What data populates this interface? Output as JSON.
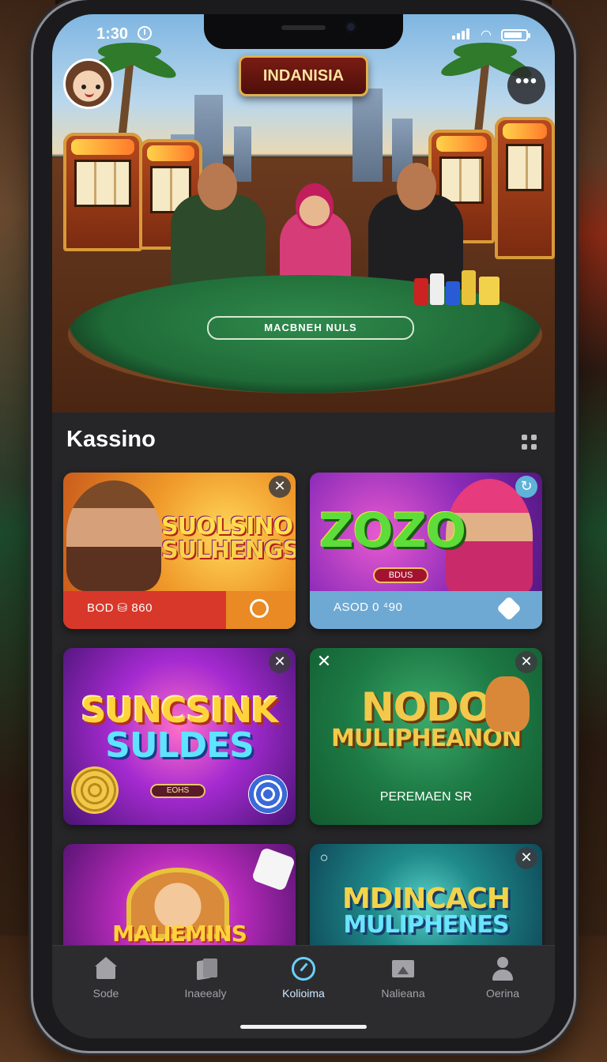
{
  "status_bar": {
    "time": "1:30"
  },
  "hero": {
    "banner": "INDANISIA",
    "table_text": "MACBNEH NULS"
  },
  "section": {
    "title": "Kassino"
  },
  "cards": [
    {
      "title_line1": "SUOLSINO",
      "title_line2": "SULHENGS",
      "bar_label": "BOD ⛁ 860",
      "badge": ""
    },
    {
      "title_line1": "ZOZO",
      "title_line2": "",
      "bar_label": "ASOD 0 ⁴90",
      "badge": "BDUS"
    },
    {
      "title_line1": "SUNCSINK",
      "title_line2": "SULDES",
      "bar_label": "",
      "badge": "EOHS"
    },
    {
      "title_line1": "NODO",
      "title_line2": "MULIPHEANON",
      "bar_label": "PEREMAEN SR",
      "badge": ""
    },
    {
      "title_line1": "MALIEMINS",
      "title_line2": "",
      "bar_label": "",
      "badge": ""
    },
    {
      "title_line1": "MDINCACH",
      "title_line2": "MULIPHENES",
      "bar_label": "",
      "badge": ""
    }
  ],
  "tabs": [
    {
      "label": "Sode",
      "icon": "home-icon",
      "active": false
    },
    {
      "label": "Inaeealy",
      "icon": "cards-icon",
      "active": false
    },
    {
      "label": "Kolioima",
      "icon": "dial-icon",
      "active": true
    },
    {
      "label": "Nalieana",
      "icon": "image-icon",
      "active": false
    },
    {
      "label": "Oerina",
      "icon": "user-icon",
      "active": false
    }
  ],
  "colors": {
    "screen_bg": "#262628",
    "tab_active": "#cfe9ff",
    "tab_inactive": "#a3a3a7"
  }
}
